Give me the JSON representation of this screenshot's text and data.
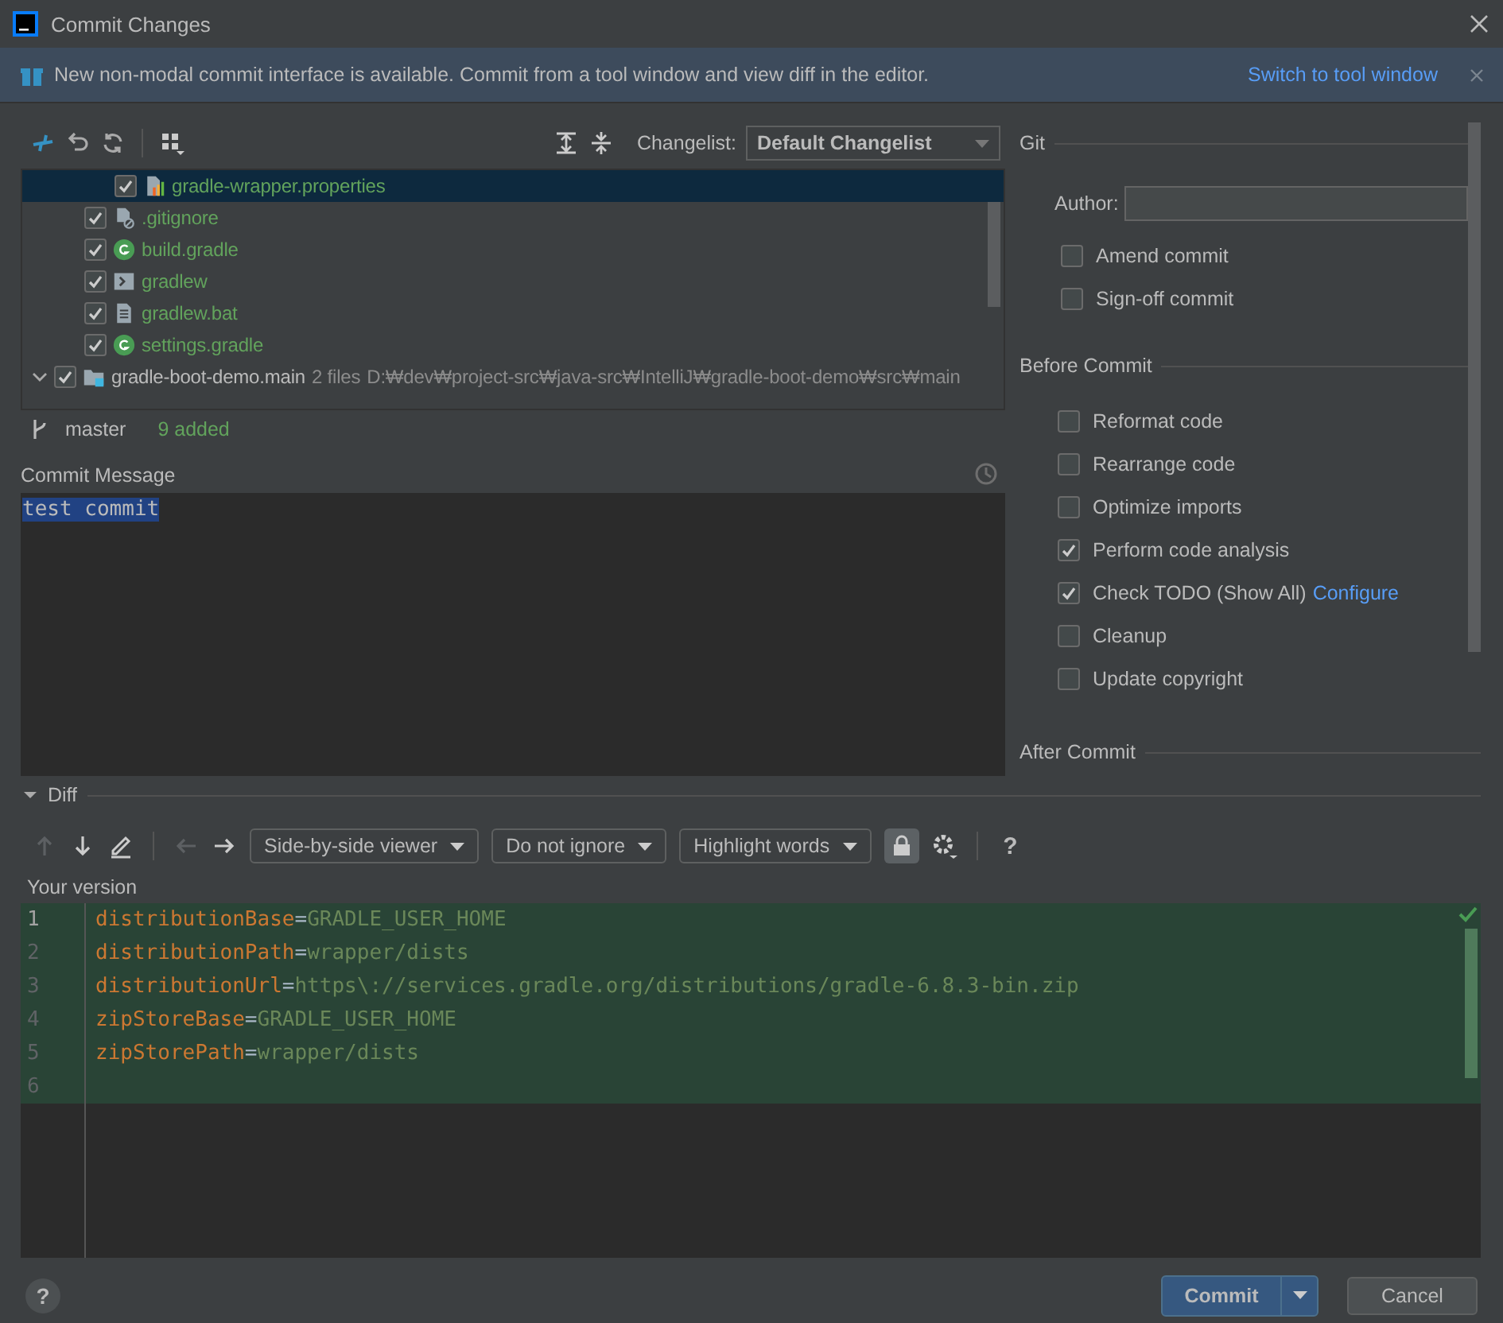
{
  "window": {
    "title": "Commit Changes"
  },
  "banner": {
    "text": "New non-modal commit interface is available. Commit from a tool window and view diff in the editor.",
    "link": "Switch to tool window"
  },
  "changelist": {
    "label": "Changelist:",
    "value": "Default Changelist"
  },
  "tree": [
    {
      "children": [
        {
          "children": [
            {
              "name": "gradle-wrapper.properties",
              "kind": "properties",
              "checked": true,
              "selected": true
            }
          ]
        },
        {
          "name": ".gitignore",
          "kind": "ignore",
          "checked": true,
          "selected": false
        },
        {
          "name": "build.gradle",
          "kind": "gradle",
          "checked": true,
          "selected": false
        },
        {
          "name": "gradlew",
          "kind": "shell",
          "checked": true,
          "selected": false
        },
        {
          "name": "gradlew.bat",
          "kind": "text",
          "checked": true,
          "selected": false
        },
        {
          "name": "settings.gradle",
          "kind": "gradle",
          "checked": true,
          "selected": false
        }
      ]
    },
    {
      "name": "gradle-boot-demo.main",
      "kind": "module",
      "count": "2 files",
      "path": "D:₩dev₩project-src₩java-src₩IntelliJ₩gradle-boot-demo₩src₩main",
      "checked": true,
      "selected": false,
      "expanded": true
    }
  ],
  "status": {
    "branch": "master",
    "summary": "9 added"
  },
  "commit_message": {
    "label": "Commit Message",
    "value": "test commit"
  },
  "git": {
    "title": "Git",
    "author_label": "Author:",
    "options": [
      {
        "label": "Amend commit",
        "checked": false
      },
      {
        "label": "Sign-off commit",
        "checked": false
      }
    ]
  },
  "before_commit": {
    "title": "Before Commit",
    "options": [
      {
        "label": "Reformat code",
        "checked": false
      },
      {
        "label": "Rearrange code",
        "checked": false
      },
      {
        "label": "Optimize imports",
        "checked": false
      },
      {
        "label": "Perform code analysis",
        "checked": true
      },
      {
        "label": "Check TODO (Show All)",
        "link": "Configure",
        "checked": true
      },
      {
        "label": "Cleanup",
        "checked": false
      },
      {
        "label": "Update copyright",
        "checked": false
      }
    ]
  },
  "after_commit": {
    "title": "After Commit"
  },
  "diff": {
    "title": "Diff",
    "expanded": true,
    "dropdowns": [
      "Side-by-side viewer",
      "Do not ignore",
      "Highlight words"
    ],
    "lock_on": true,
    "help": "?",
    "caption": "Your version",
    "lines": [
      {
        "number": "1",
        "key": "distributionBase",
        "sep": "=",
        "value": "GRADLE_USER_HOME",
        "current": true
      },
      {
        "number": "2",
        "key": "distributionPath",
        "sep": "=",
        "value": "wrapper/dists",
        "current": false
      },
      {
        "number": "3",
        "key": "distributionUrl",
        "sep": "=",
        "value": "https\\://services.gradle.org/distributions/gradle-6.8.3-bin.zip",
        "current": false
      },
      {
        "number": "4",
        "key": "zipStoreBase",
        "sep": "=",
        "value": "GRADLE_USER_HOME",
        "current": false
      },
      {
        "number": "5",
        "key": "zipStorePath",
        "sep": "=",
        "value": "wrapper/dists",
        "current": false
      },
      {
        "number": "6",
        "current": false
      }
    ]
  },
  "buttons": {
    "help": "?",
    "commit": "Commit",
    "cancel": "Cancel"
  }
}
